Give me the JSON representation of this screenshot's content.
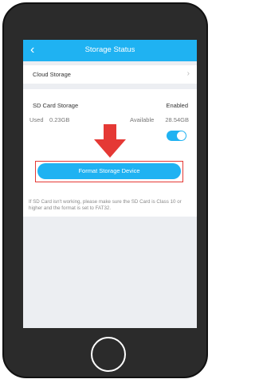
{
  "header": {
    "back_icon": "chevron-left-icon",
    "title": "Storage Status",
    "color": "#1fb2f2"
  },
  "cloud": {
    "label": "Cloud Storage",
    "chevron": "›"
  },
  "sd": {
    "label": "SD Card Storage",
    "status": "Enabled",
    "used_label": "Used",
    "used_value": "0.23GB",
    "available_label": "Available",
    "available_value": "28.54GB",
    "toggle_on": true
  },
  "format_button": "Format Storage Device",
  "note": "If SD Card isn't working, please make sure the SD Card is Class 10 or higher and the format is set to FAT32.",
  "annotation": {
    "arrow_color": "#e53935",
    "highlight_color": "#e53935"
  }
}
